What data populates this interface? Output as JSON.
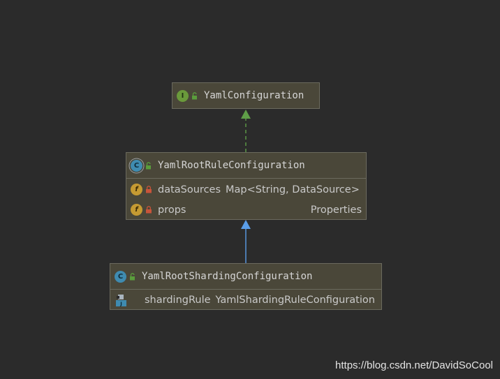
{
  "diagram": {
    "nodes": [
      {
        "id": "yaml-configuration",
        "kind": "interface",
        "badge": "I",
        "title": "YamlConfiguration",
        "fields": []
      },
      {
        "id": "yaml-root-rule-configuration",
        "kind": "abstract-class",
        "badge": "C",
        "title": "YamlRootRuleConfiguration",
        "fields": [
          {
            "badge": "f",
            "name": "dataSources",
            "type": "Map<String, DataSource>"
          },
          {
            "badge": "f",
            "name": "props",
            "type": "Properties"
          }
        ]
      },
      {
        "id": "yaml-root-sharding-configuration",
        "kind": "class",
        "badge": "C",
        "title": "YamlRootShardingConfiguration",
        "fields": [
          {
            "badge": "property-icon",
            "name": "shardingRule",
            "type": "YamlShardingRuleConfiguration"
          }
        ]
      }
    ],
    "edges": [
      {
        "from": "yaml-root-rule-configuration",
        "to": "yaml-configuration",
        "style": "dashed",
        "color": "#5f9e48"
      },
      {
        "from": "yaml-root-sharding-configuration",
        "to": "yaml-root-rule-configuration",
        "style": "solid",
        "color": "#5a9de8"
      }
    ]
  },
  "watermark": "https://blog.csdn.net/DavidSoCool"
}
